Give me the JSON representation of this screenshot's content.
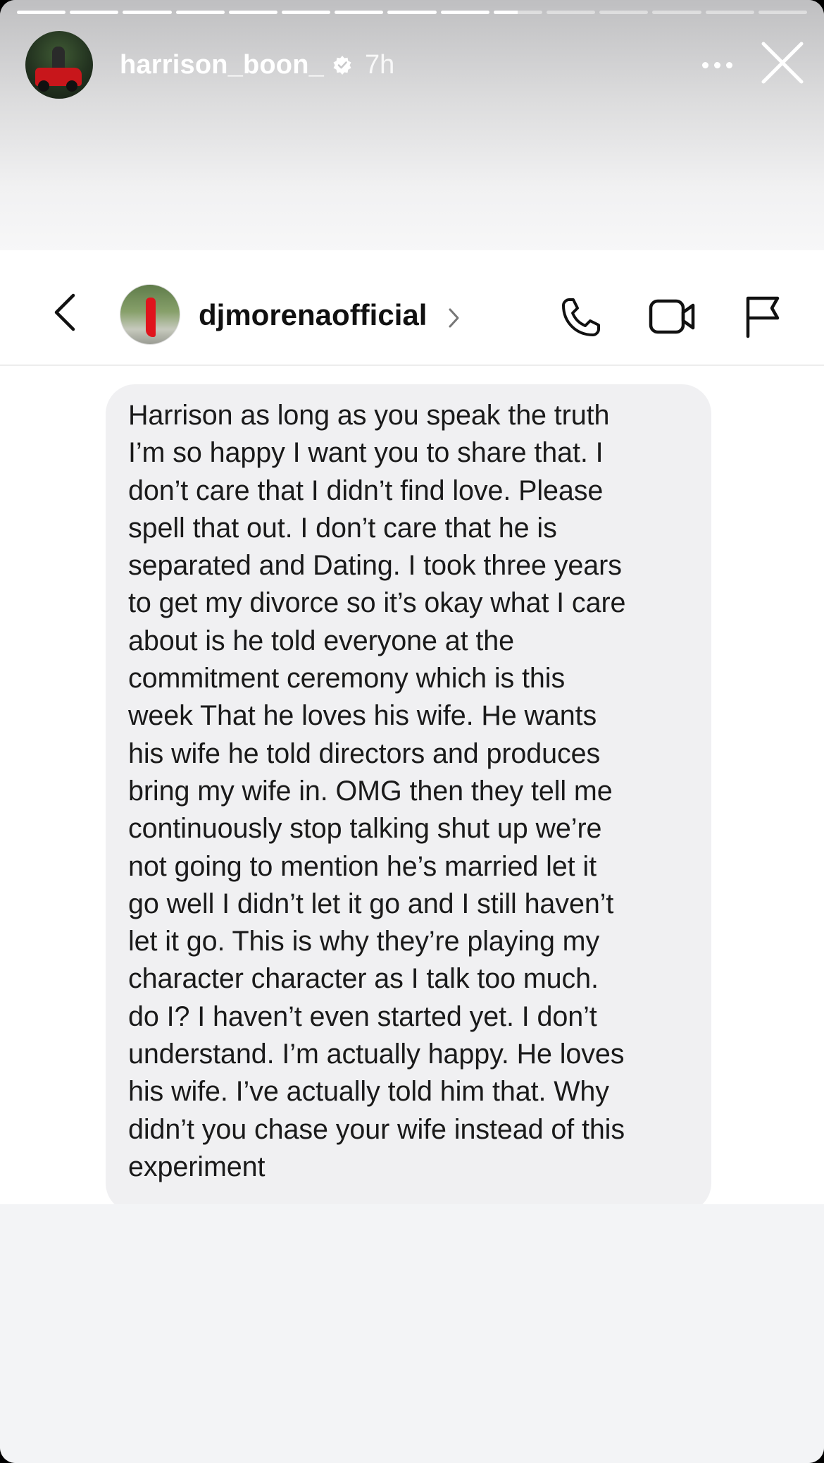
{
  "story": {
    "username": "harrison_boon_",
    "time": "7h",
    "progress_segments": 15,
    "progress_fill": [
      1,
      1,
      1,
      1,
      1,
      1,
      1,
      1,
      1,
      0.5,
      0,
      0,
      0,
      0,
      0
    ],
    "icons": {
      "avatar": "profile-avatar",
      "verified": "verified-badge-icon",
      "more": "more-options-icon",
      "close": "close-icon"
    }
  },
  "dm": {
    "contact_name": "djmorenaofficial",
    "icons": {
      "back": "back-arrow-icon",
      "chevron": "chevron-right-icon",
      "call": "phone-icon",
      "video": "video-camera-icon",
      "flag": "flag-icon"
    },
    "message": "Harrison as long as you speak the truth\nI’m so happy I want you to share that. I\ndon’t care that I didn’t find love. Please\nspell that out. I don’t care that he is\nseparated and Dating. I took three years\nto get my divorce so it’s okay what I care\nabout is he told everyone at the\ncommitment ceremony which is this\nweek That he loves his wife. He wants\nhis wife he told directors and produces\nbring my wife in. OMG then they tell me\ncontinuously stop talking shut up we’re\nnot going to mention he’s married let it\ngo well I didn’t let it go and I still haven’t\nlet it go. This is why they’re playing my\ncharacter character as I talk too much.\ndo I? I haven’t even started yet. I don’t\nunderstand. I’m actually happy. He loves\nhis wife. I’ve actually told him that. Why\ndidn’t you chase your wife instead of this\nexperiment"
  },
  "colors": {
    "bubble": "#f0f0f2",
    "text": "#1a1a1a",
    "accent_red": "#c8161b"
  }
}
